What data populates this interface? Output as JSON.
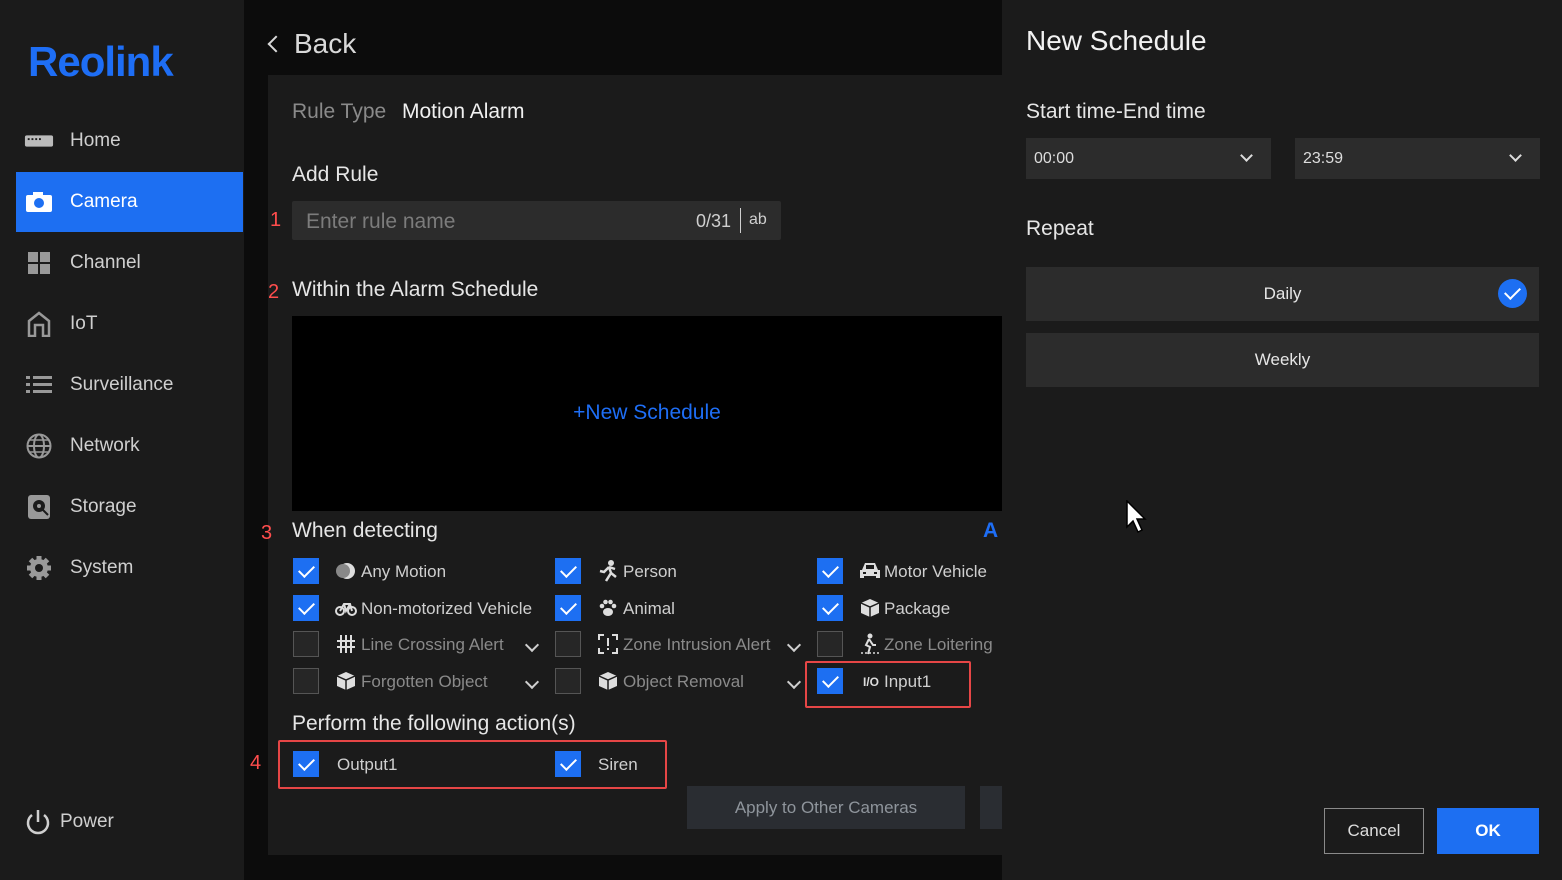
{
  "sidebar": {
    "logo": "Reolink",
    "items": [
      {
        "label": "Home",
        "icon": "home-icon"
      },
      {
        "label": "Camera",
        "icon": "camera-icon",
        "active": true
      },
      {
        "label": "Channel",
        "icon": "channel-icon"
      },
      {
        "label": "IoT",
        "icon": "iot-icon"
      },
      {
        "label": "Surveillance",
        "icon": "list-icon"
      },
      {
        "label": "Network",
        "icon": "globe-icon"
      },
      {
        "label": "Storage",
        "icon": "storage-icon"
      },
      {
        "label": "System",
        "icon": "gear-icon"
      }
    ],
    "power": "Power"
  },
  "main": {
    "back": "Back",
    "rule_type_label": "Rule Type",
    "rule_type_value": "Motion Alarm",
    "add_rule": "Add Rule",
    "rule_name_placeholder": "Enter rule name",
    "rule_name_counter": "0/31",
    "rule_name_ab": "ab",
    "within_schedule": "Within the Alarm Schedule",
    "new_schedule": "+New Schedule",
    "when_detecting": "When detecting",
    "when_detecting_link": "A",
    "detections": [
      {
        "label": "Any Motion",
        "checked": true
      },
      {
        "label": "Person",
        "checked": true
      },
      {
        "label": "Motor Vehicle",
        "checked": true
      },
      {
        "label": "Non-motorized Vehicle",
        "checked": true
      },
      {
        "label": "Animal",
        "checked": true
      },
      {
        "label": "Package",
        "checked": true
      },
      {
        "label": "Line Crossing Alert",
        "checked": false
      },
      {
        "label": "Zone Intrusion Alert",
        "checked": false
      },
      {
        "label": "Zone Loitering",
        "checked": false
      },
      {
        "label": "Forgotten Object",
        "checked": false
      },
      {
        "label": "Object Removal",
        "checked": false
      },
      {
        "label": "Input1",
        "icon_text": "I/O",
        "checked": true
      }
    ],
    "perform_actions": "Perform the following action(s)",
    "actions": [
      {
        "label": "Output1",
        "checked": true
      },
      {
        "label": "Siren",
        "checked": true
      }
    ],
    "apply_button": "Apply to Other Cameras",
    "annotations": [
      "1",
      "2",
      "3",
      "4"
    ]
  },
  "schedule_panel": {
    "title": "New Schedule",
    "time_label": "Start time-End time",
    "start_time": "00:00",
    "end_time": "23:59",
    "repeat_label": "Repeat",
    "repeat_options": [
      {
        "label": "Daily",
        "selected": true
      },
      {
        "label": "Weekly",
        "selected": false
      }
    ],
    "cancel": "Cancel",
    "ok": "OK"
  },
  "colors": {
    "accent": "#1d6ff2",
    "annotation": "#e64646"
  }
}
